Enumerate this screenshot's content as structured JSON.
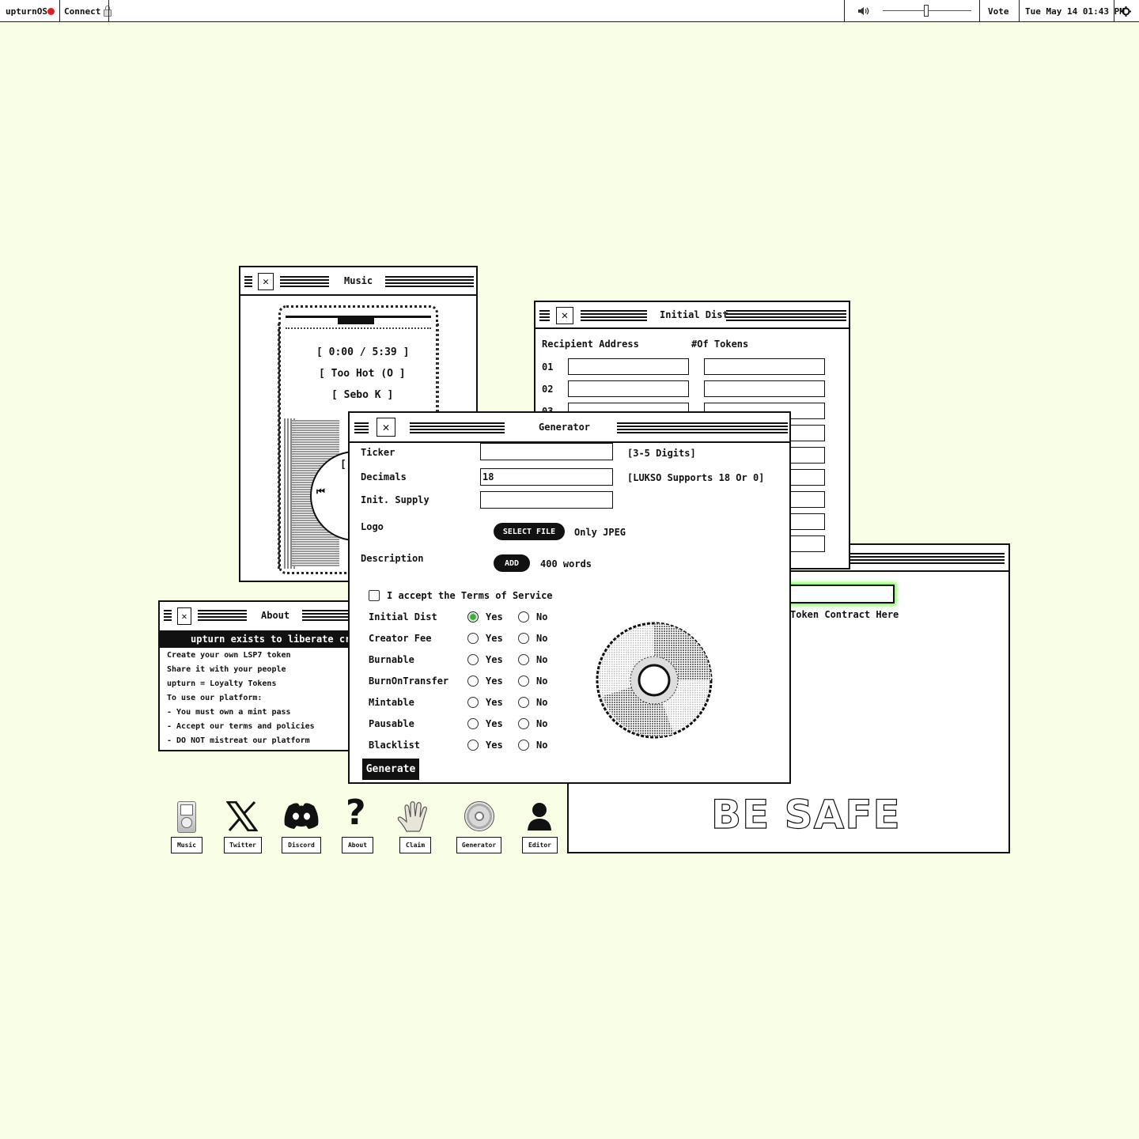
{
  "menubar": {
    "app_name": "upturnOS",
    "connect_label": "Connect",
    "vote_label": "Vote",
    "datetime": "Tue May 14 01:43 PM",
    "volume": 0.5,
    "icons": [
      "red-dot-icon",
      "lock-icon",
      "speaker-icon",
      "settings-gear-icon"
    ]
  },
  "music": {
    "title": "Music",
    "time": "[ 0:00 / 5:39 ]",
    "track": "[ Too Hot (O ]",
    "artist": "[ Sebo K ]",
    "partial_label": "[!"
  },
  "initial_dist": {
    "title": "Initial Dist",
    "col_address": "Recipient Address",
    "col_tokens": "#Of Tokens",
    "rows": [
      "01",
      "02",
      "03"
    ]
  },
  "editor_window": {
    "partial_title": ".",
    "hint": "Token Contract Here",
    "watermark": "BE SAFE"
  },
  "about": {
    "title": "About",
    "banner": "upturn exists to liberate creato",
    "lines": [
      "Create your own LSP7 token",
      "Share it with your people",
      "upturn = Loyalty Tokens",
      "To use our platform:",
      "- You must own a mint pass",
      "- Accept our terms and policies",
      "- DO NOT mistreat our platform"
    ]
  },
  "generator": {
    "title": "Generator",
    "ticker_label": "Ticker",
    "ticker_value": "",
    "ticker_hint": "[3-5 Digits]",
    "decimals_label": "Decimals",
    "decimals_value": "18",
    "decimals_hint": "[LUKSO Supports 18 Or 0]",
    "supply_label": "Init. Supply",
    "supply_value": "",
    "logo_label": "Logo",
    "select_file": "SELECT FILE",
    "logo_hint": "Only JPEG",
    "description_label": "Description",
    "add_label": "ADD",
    "description_hint": "400 words",
    "terms_label": "I accept the Terms of Service",
    "terms_checked": false,
    "yes_label": "Yes",
    "no_label": "No",
    "options": [
      {
        "label": "Initial Dist",
        "selected": "yes"
      },
      {
        "label": "Creator Fee",
        "selected": null
      },
      {
        "label": "Burnable",
        "selected": null
      },
      {
        "label": "BurnOnTransfer",
        "selected": null
      },
      {
        "label": "Mintable",
        "selected": null
      },
      {
        "label": "Pausable",
        "selected": null
      },
      {
        "label": "Blacklist",
        "selected": null
      }
    ],
    "generate_label": "Generate",
    "accent_color": "#3caa3c"
  },
  "dock": [
    {
      "label": "Music",
      "icon": "ipod-icon"
    },
    {
      "label": "Twitter",
      "icon": "x-logo-icon"
    },
    {
      "label": "Discord",
      "icon": "discord-logo-icon"
    },
    {
      "label": "About",
      "icon": "question-mark-icon"
    },
    {
      "label": "Claim",
      "icon": "hand-icon"
    },
    {
      "label": "Generator",
      "icon": "disc-icon"
    },
    {
      "label": "Editor",
      "icon": "user-silhouette-icon"
    }
  ],
  "colors": {
    "background": "#f8fde6",
    "highlight_border": "#66ff33"
  }
}
